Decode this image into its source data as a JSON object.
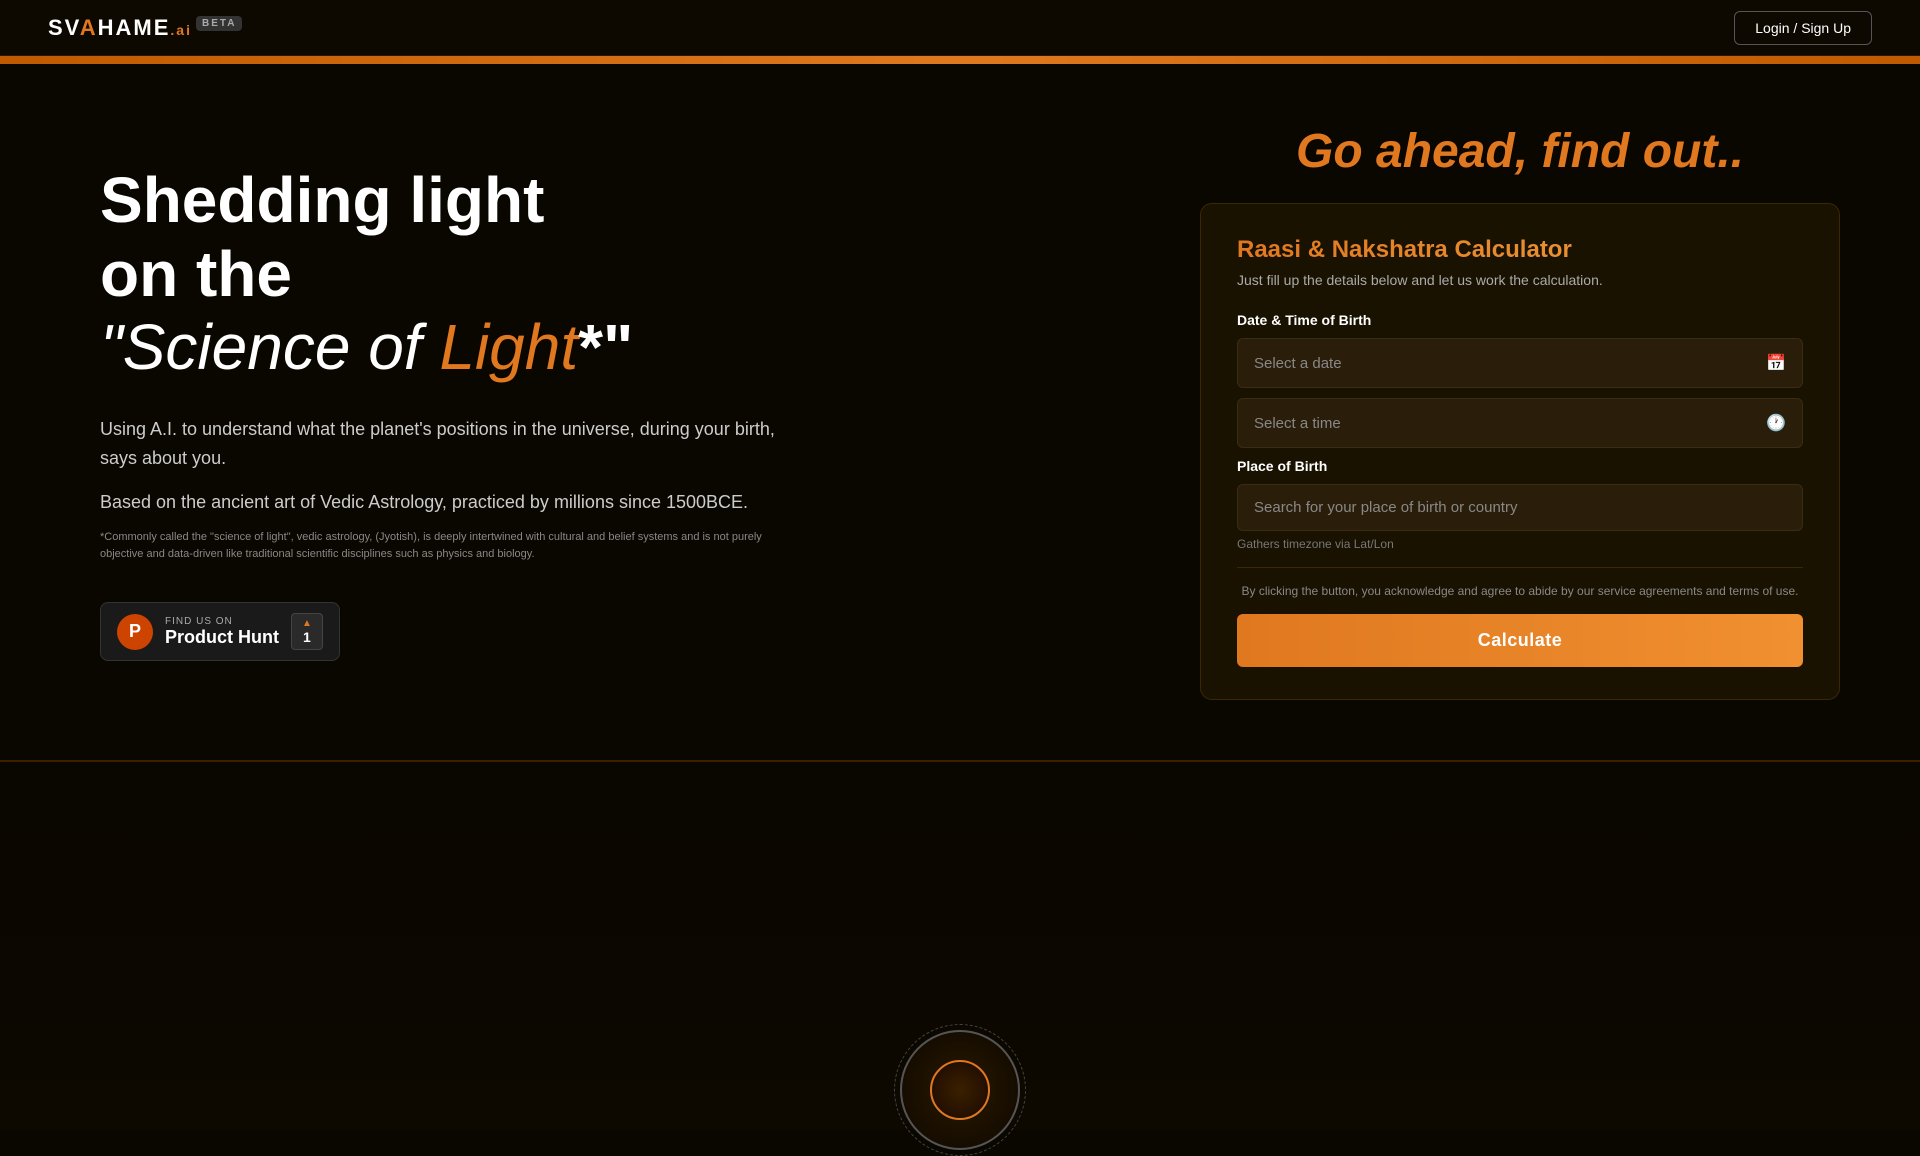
{
  "header": {
    "logo": {
      "sv": "SV",
      "a": "A",
      "hame": "H",
      "name_full": "SVAHAME",
      "ai_suffix": ".ai",
      "beta_label": "BETA"
    },
    "login_button": "Login / Sign Up"
  },
  "hero": {
    "go_ahead_title": "Go ahead, find out..",
    "headline_line1": "Shedding light",
    "headline_line2": "on the",
    "headline_italic": "\"Science of ",
    "headline_orange": "Light",
    "headline_suffix": "*\"",
    "description": "Using A.I. to understand what the planet's positions in the universe, during your birth, says about you.",
    "based_on": "Based on the ancient art of Vedic Astrology, practiced by millions since 1500BCE.",
    "fine_print": "*Commonly called the \"science of light\", vedic astrology, (Jyotish), is deeply intertwined with cultural and belief systems and is not purely objective and data-driven like traditional scientific disciplines such as physics and biology."
  },
  "product_hunt": {
    "find_us_label": "FIND US ON",
    "name": "Product Hunt",
    "count": "1",
    "icon_letter": "P"
  },
  "calculator": {
    "title": "Raasi & Nakshatra Calculator",
    "subtitle": "Just fill up the details below and let us work the calculation.",
    "date_time_label": "Date & Time of Birth",
    "date_placeholder": "Select a date",
    "time_placeholder": "Select a time",
    "place_label": "Place of Birth",
    "place_placeholder": "Search for your place of birth or country",
    "timezone_note": "Gathers timezone via Lat/Lon",
    "terms_text": "By clicking the button, you acknowledge and agree to abide by our service agreements and terms of use.",
    "calculate_button": "Calculate"
  }
}
